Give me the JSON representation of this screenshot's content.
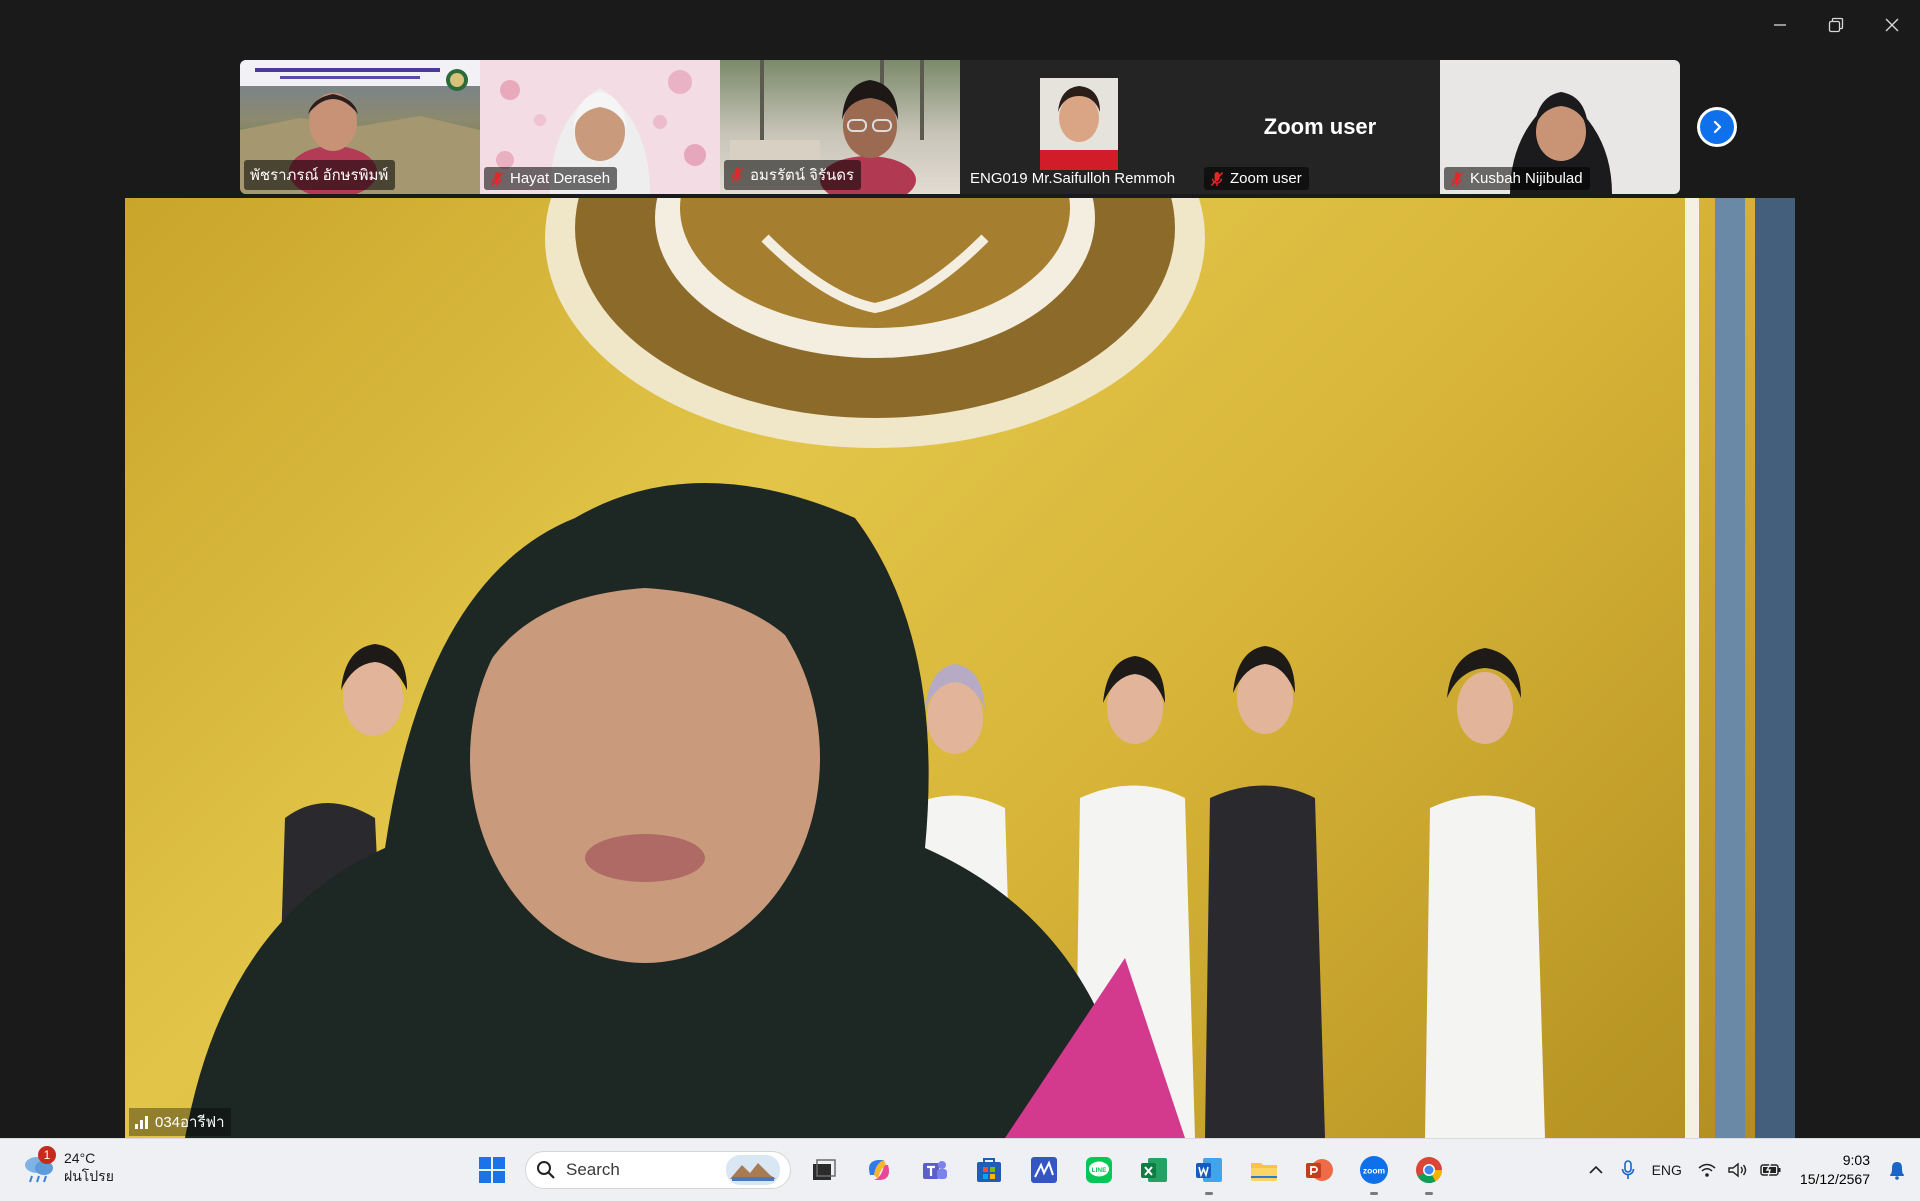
{
  "gallery": {
    "tiles": [
      {
        "name": "พัชราภรณ์ อักษรพิมพ์",
        "muted": false
      },
      {
        "name": "Hayat Deraseh",
        "muted": true
      },
      {
        "name": "อมรรัตน์ จิรันดร",
        "muted": true
      },
      {
        "name": "ENG019 Mr.Saifulloh Remmoh",
        "muted": false
      },
      {
        "name": "Zoom user",
        "muted": true,
        "center_name": "Zoom user"
      },
      {
        "name": "Kusbah Nijibulad",
        "muted": true
      }
    ]
  },
  "main_video": {
    "speaker_name": "034อารีฟา"
  },
  "taskbar": {
    "weather": {
      "badge": "1",
      "temperature": "24°C",
      "condition": "ฝนโปรย"
    },
    "search_placeholder": "Search",
    "language": "ENG",
    "time": "9:03",
    "date": "15/12/2567"
  },
  "colors": {
    "zoom_blue": "#0e71eb",
    "mic_muted": "#e02828",
    "taskbar_bg": "#eef0f3"
  }
}
